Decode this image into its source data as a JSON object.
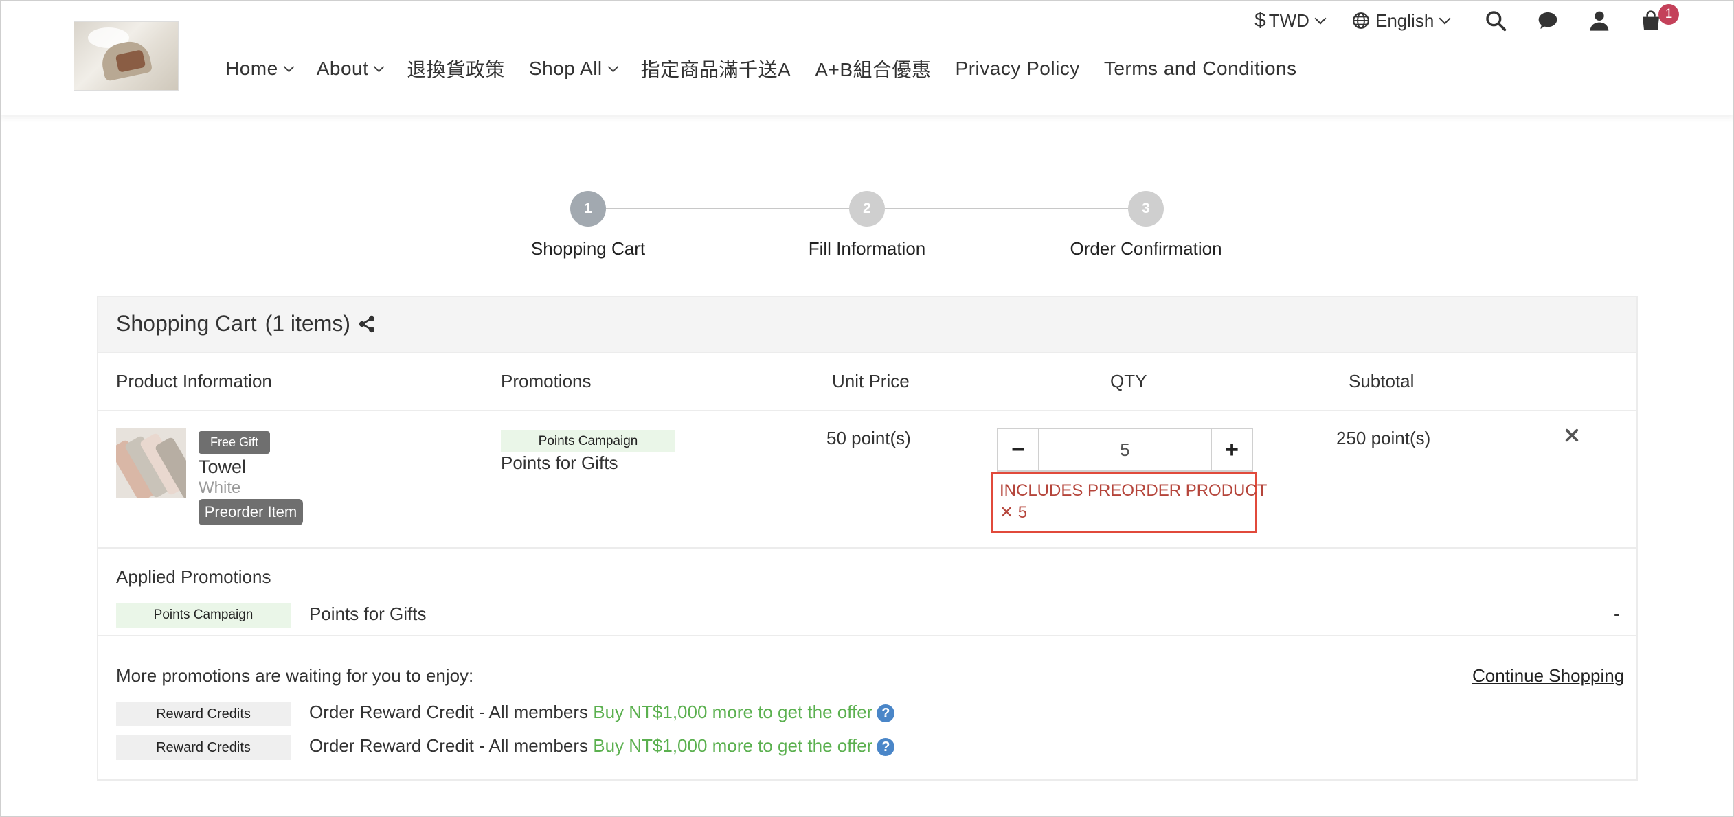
{
  "header": {
    "currency": {
      "symbol": "$",
      "code": "TWD"
    },
    "language": "English",
    "cart_count": "1",
    "nav": [
      {
        "label": "Home",
        "has_dropdown": true
      },
      {
        "label": "About",
        "has_dropdown": true
      },
      {
        "label": "退換貨政策",
        "has_dropdown": false
      },
      {
        "label": "Shop All",
        "has_dropdown": true
      },
      {
        "label": "指定商品滿千送A",
        "has_dropdown": false
      },
      {
        "label": "A+B組合優惠",
        "has_dropdown": false
      },
      {
        "label": "Privacy Policy",
        "has_dropdown": false
      },
      {
        "label": "Terms and Conditions",
        "has_dropdown": false
      }
    ],
    "icons": [
      "dollar-icon",
      "globe-icon",
      "search-icon",
      "chat-icon",
      "user-icon",
      "cart-icon"
    ]
  },
  "steps": [
    {
      "number": "1",
      "label": "Shopping Cart",
      "active": true
    },
    {
      "number": "2",
      "label": "Fill Information",
      "active": false
    },
    {
      "number": "3",
      "label": "Order Confirmation",
      "active": false
    }
  ],
  "cart": {
    "title": "Shopping Cart",
    "count_text": "(1 items)",
    "columns": {
      "product": "Product Information",
      "promotions": "Promotions",
      "unit_price": "Unit Price",
      "qty": "QTY",
      "subtotal": "Subtotal"
    },
    "item": {
      "gift_tag": "Free Gift",
      "name": "Towel",
      "variant": "White",
      "preorder_tag": "Preorder Item",
      "promo_tag": "Points Campaign",
      "promo_name": "Points for Gifts",
      "unit_price": "50 point(s)",
      "quantity": "5",
      "subtotal": "250 point(s)",
      "warning_line1": "INCLUDES PREORDER PRODUCT",
      "warning_line2": "✕ 5"
    },
    "applied": {
      "heading": "Applied Promotions",
      "tag": "Points Campaign",
      "name": "Points for Gifts",
      "value": "-"
    },
    "more": {
      "heading": "More promotions are waiting for you to enjoy:",
      "continue_label": "Continue Shopping",
      "offers": [
        {
          "tag": "Reward Credits",
          "name": "Order Reward Credit - All members",
          "hint": "Buy NT$1,000 more to get the offer"
        },
        {
          "tag": "Reward Credits",
          "name": "Order Reward Credit - All members",
          "hint": "Buy NT$1,000 more to get the offer"
        }
      ]
    }
  },
  "colors": {
    "active_step": "#a2a9b0",
    "inactive_step": "#cfcfcf",
    "cart_badge": "#c4415a",
    "warning": "#e14a3b",
    "offer_hint": "#5bb04f",
    "promo_tag_bg": "#eaf6e8",
    "help_icon": "#4a86c8"
  }
}
